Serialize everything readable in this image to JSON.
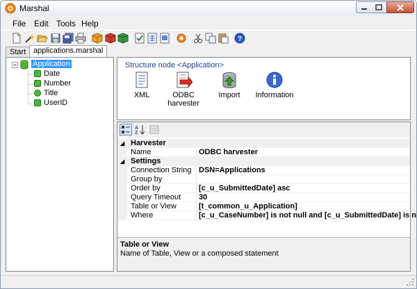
{
  "window": {
    "title": "Marshal"
  },
  "menu": {
    "items": [
      "File",
      "Edit",
      "Tools",
      "Help"
    ]
  },
  "toolbar": {
    "buttons": [
      "new-icon",
      "wand-icon",
      "open-folder-icon",
      "save-icon",
      "save-all-icon",
      "print-icon",
      "cube-orange-icon",
      "cube-red-icon",
      "cube-green-icon",
      "document-check-icon",
      "document-grid-icon",
      "document-export-icon",
      "gear-icon",
      "cut-icon",
      "copy-icon",
      "paste-icon",
      "help-icon"
    ]
  },
  "tabs": [
    {
      "label": "Start",
      "active": false
    },
    {
      "label": "applications.marshal",
      "active": true
    }
  ],
  "tree": {
    "root": {
      "label": "Application",
      "selected": true
    },
    "children": [
      {
        "label": "Date",
        "icon": "field-icon"
      },
      {
        "label": "Number",
        "icon": "field-icon"
      },
      {
        "label": "Title",
        "icon": "key-field-icon"
      },
      {
        "label": "UserID",
        "icon": "field-icon"
      }
    ]
  },
  "structure": {
    "title": "Structure node <Application>",
    "icons": [
      {
        "label": "XML",
        "icon": "xml-icon"
      },
      {
        "label": "ODBC harvester",
        "line1": "ODBC",
        "line2": "harvester",
        "icon": "odbc-harvester-icon"
      },
      {
        "label": "Import",
        "icon": "import-icon"
      },
      {
        "label": "Information",
        "icon": "information-icon"
      }
    ]
  },
  "property_grid": {
    "categories": [
      {
        "name": "Harvester",
        "rows": [
          {
            "name": "Name",
            "value": "ODBC harvester"
          }
        ]
      },
      {
        "name": "Settings",
        "rows": [
          {
            "name": "Connection String",
            "value": "DSN=Applications"
          },
          {
            "name": "Group by",
            "value": ""
          },
          {
            "name": "Order by",
            "value": "[c_u_SubmittedDate] asc"
          },
          {
            "name": "Query Timeout",
            "value": "30"
          },
          {
            "name": "Table or View",
            "value": "[t_common_u_Application]"
          },
          {
            "name": "Where",
            "value": "[c_u_CaseNumber] is not null and [c_u_SubmittedDate] is not null"
          }
        ]
      }
    ],
    "description": {
      "title": "Table or View",
      "text": "Name of Table, View or a composed statement"
    }
  }
}
